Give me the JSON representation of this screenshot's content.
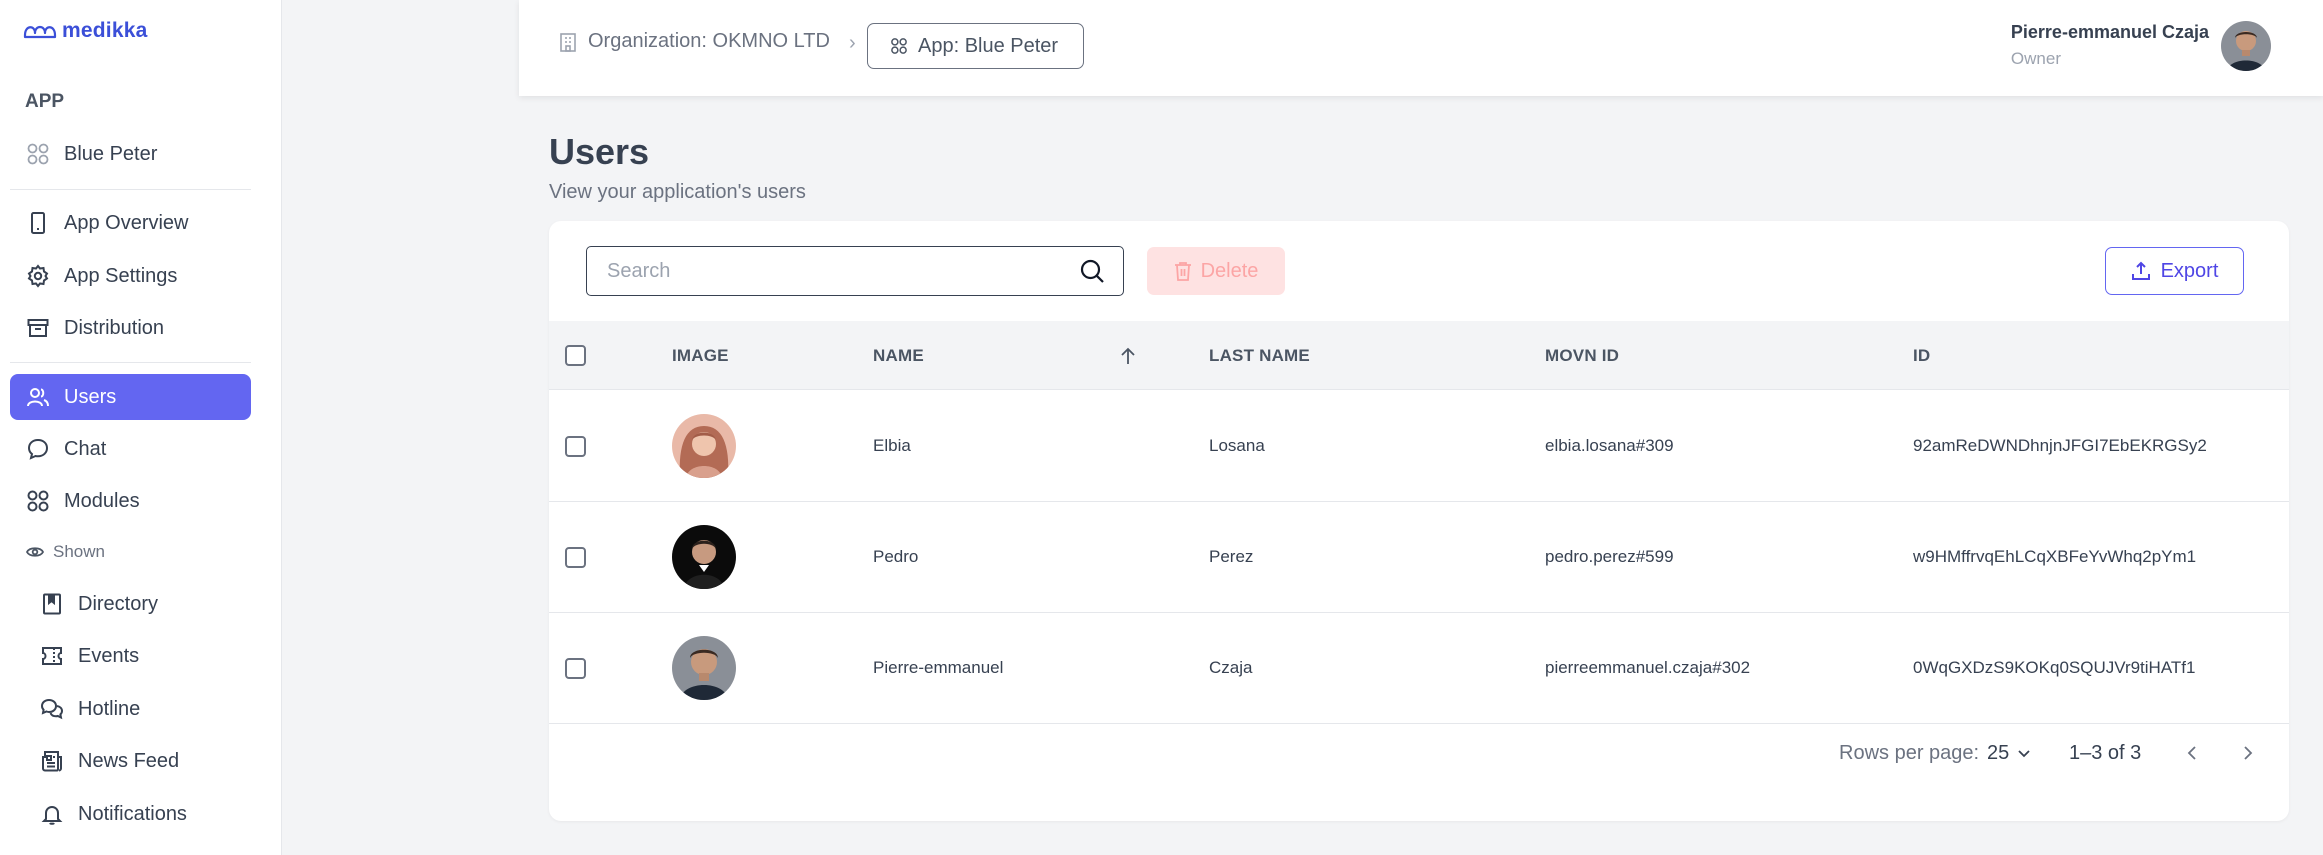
{
  "brand": {
    "name": "medikka",
    "color": "#3b4fd8"
  },
  "sidebar": {
    "section_label": "APP",
    "app_item": {
      "label": "Blue Peter",
      "icon": "grid-icon"
    },
    "items": [
      {
        "label": "App Overview",
        "icon": "phone-icon"
      },
      {
        "label": "App Settings",
        "icon": "gear-icon"
      },
      {
        "label": "Distribution",
        "icon": "archive-icon"
      },
      {
        "label": "Users",
        "icon": "users-icon",
        "active": true
      },
      {
        "label": "Chat",
        "icon": "chat-icon"
      },
      {
        "label": "Modules",
        "icon": "modules-icon"
      }
    ],
    "shown_label": "Shown",
    "modules": [
      {
        "label": "Directory",
        "icon": "book-icon"
      },
      {
        "label": "Events",
        "icon": "ticket-icon"
      },
      {
        "label": "Hotline",
        "icon": "chat-bubbles-icon"
      },
      {
        "label": "News Feed",
        "icon": "newspaper-icon"
      },
      {
        "label": "Notifications",
        "icon": "bell-icon"
      }
    ]
  },
  "header": {
    "organization_crumb": "Organization: OKMNO LTD",
    "app_crumb": "App: Blue Peter",
    "user_name": "Pierre-emmanuel Czaja",
    "user_role": "Owner"
  },
  "page": {
    "title": "Users",
    "subtitle": "View your application's users"
  },
  "toolbar": {
    "search_placeholder": "Search",
    "search_value": "",
    "delete_label": "Delete",
    "export_label": "Export"
  },
  "table": {
    "columns": {
      "image": "IMAGE",
      "name": "NAME",
      "last_name": "LAST NAME",
      "movn_id": "MOVN ID",
      "id": "ID"
    },
    "sort": {
      "column": "name",
      "direction": "asc"
    },
    "rows": [
      {
        "name": "Elbia",
        "last_name": "Losana",
        "movn_id": "elbia.losana#309",
        "id": "92amReDWNDhnjnJFGI7EbEKRGSy2"
      },
      {
        "name": "Pedro",
        "last_name": "Perez",
        "movn_id": "pedro.perez#599",
        "id": "w9HMffrvqEhLCqXBFeYvWhq2pYm1"
      },
      {
        "name": "Pierre-emmanuel",
        "last_name": "Czaja",
        "movn_id": "pierreemmanuel.czaja#302",
        "id": "0WqGXDzS9KOKq0SQUJVr9tiHATf1"
      }
    ]
  },
  "pagination": {
    "rows_per_page_label": "Rows per page:",
    "rows_per_page_value": "25",
    "range_label": "1–3 of 3"
  },
  "colors": {
    "accent": "#6366f1",
    "delete_bg": "#fee2e2",
    "delete_text": "#fca5a5"
  }
}
